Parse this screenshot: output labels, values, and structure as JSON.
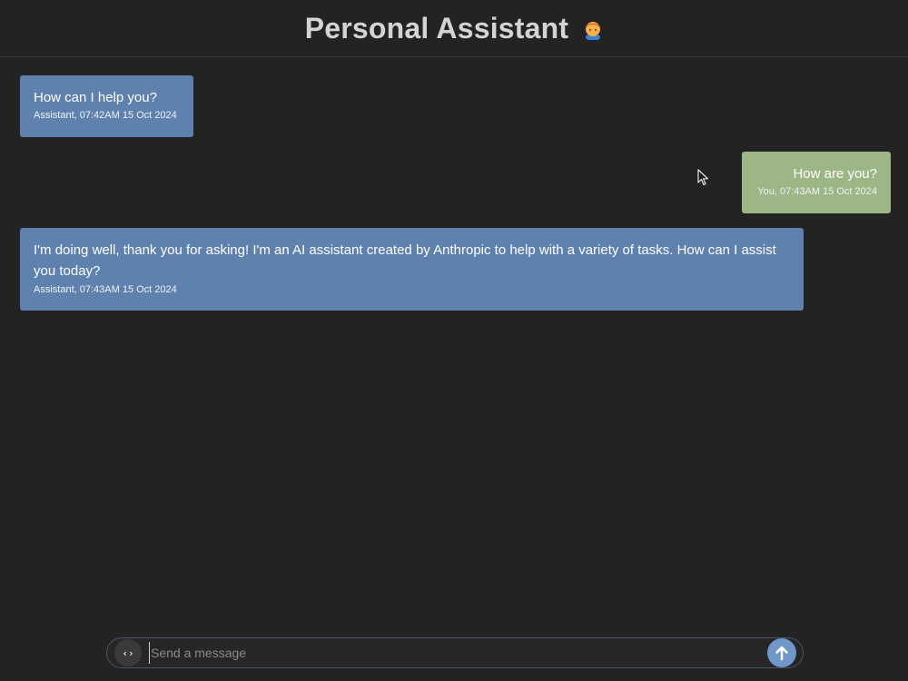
{
  "header": {
    "title": "Personal Assistant",
    "avatar_icon": "person-avatar-icon"
  },
  "messages": [
    {
      "role": "assistant",
      "text": "How can I help you?",
      "meta": "Assistant, 07:42AM 15 Oct 2024"
    },
    {
      "role": "user",
      "text": "How are you?",
      "meta": "You, 07:43AM 15 Oct 2024"
    },
    {
      "role": "assistant",
      "text": "I'm doing well, thank you for asking! I'm an AI assistant created by Anthropic to help with a variety of tasks. How can I assist you today?",
      "meta": "Assistant, 07:43AM 15 Oct 2024"
    }
  ],
  "composer": {
    "code_button_label": "‹›",
    "placeholder": "Send a message",
    "value": "",
    "send_icon": "arrow-up-icon"
  },
  "colors": {
    "background": "#232323",
    "assistant_bubble": "#5f81ad",
    "user_bubble": "#9cb686",
    "send_button": "#6f97c9",
    "title_text": "#d4d4d4"
  }
}
